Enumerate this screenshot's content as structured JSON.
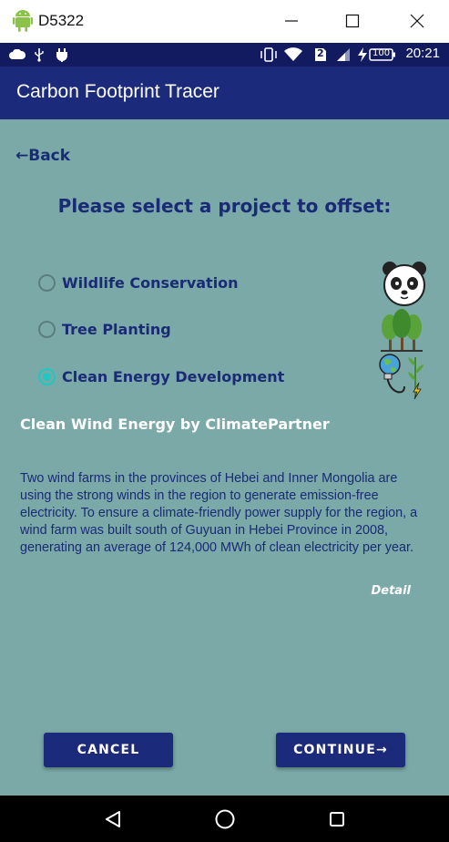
{
  "window": {
    "title": "D5322",
    "icons": [
      "android-icon",
      "minimize-icon",
      "maximize-icon",
      "close-icon"
    ]
  },
  "status_bar": {
    "time": "20:21",
    "sim_badge": "2",
    "battery_text": "100",
    "icons": [
      "cloud-icon",
      "usb-icon",
      "plug-icon",
      "vibrate-icon",
      "wifi-icon",
      "signal-icon",
      "battery-charging-icon"
    ]
  },
  "app_bar": {
    "title": "Carbon Footprint Tracer"
  },
  "main": {
    "back_label": "←Back",
    "heading": "Please select a project to offset:",
    "options": [
      {
        "label": "Wildlife Conservation",
        "selected": false,
        "icon": "panda-icon"
      },
      {
        "label": "Tree Planting",
        "selected": false,
        "icon": "trees-icon"
      },
      {
        "label": "Clean Energy Development",
        "selected": true,
        "icon": "clean-energy-icon"
      }
    ],
    "project_title": "Clean Wind Energy by ClimatePartner",
    "description": "Two wind farms in the provinces of Hebei and Inner Mongolia are using the strong winds in the region to generate emission-free electricity. To ensure a climate-friendly power supply for the region, a wind farm was built south of Guyuan in Hebei Province in 2008, generating an average of 124,000 MWh of clean electricity per year.",
    "detail_link": "Detail",
    "cancel_label": "CANCEL",
    "continue_label": "CONTINUE→"
  },
  "nav_bar": {
    "icons": [
      "back-triangle-icon",
      "home-circle-icon",
      "recents-square-icon"
    ]
  },
  "colors": {
    "status_bar_bg": "#121b5f",
    "app_bar_bg": "#1b2a7a",
    "content_bg": "#7aa9a7",
    "primary_text": "#1a2b76",
    "radio_selected": "#1ec9c1"
  }
}
